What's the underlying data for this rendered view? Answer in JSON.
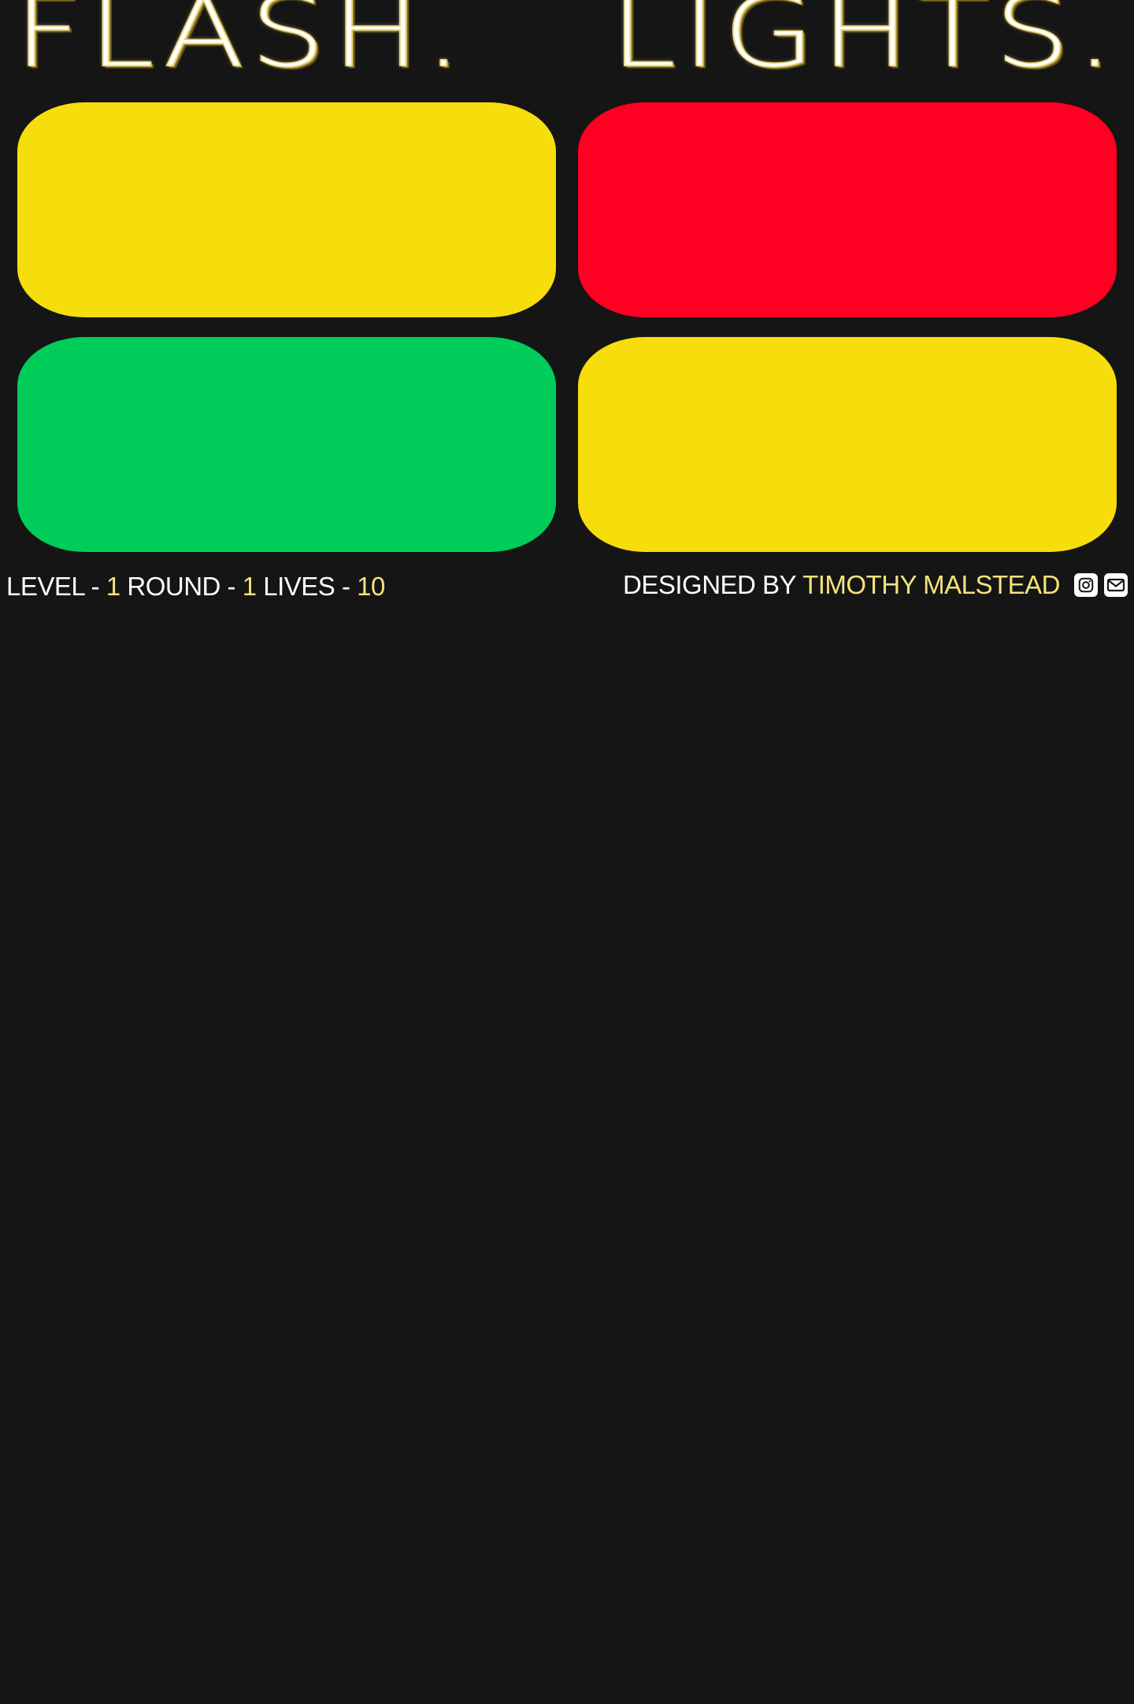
{
  "header": {
    "title_left": "FLASH.",
    "title_right": "LIGHTS."
  },
  "lights": [
    {
      "position": "top-left",
      "color": "#f6dd0c"
    },
    {
      "position": "top-right",
      "color": "#ff0022"
    },
    {
      "position": "bottom-left",
      "color": "#00cc5a"
    },
    {
      "position": "bottom-right",
      "color": "#f8dd0c"
    }
  ],
  "status": {
    "level_label": "LEVEL -",
    "level_value": "1",
    "round_label": "ROUND -",
    "round_value": "1",
    "lives_label": "LIVES -",
    "lives_value": "10"
  },
  "footer": {
    "designed_by_label": "DESIGNED BY",
    "designer_name": "TIMOTHY MALSTEAD",
    "icons": [
      "instagram-icon",
      "mail-icon"
    ]
  },
  "colors": {
    "background": "#151515",
    "accent": "#f6e27a",
    "text": "#ffffff"
  }
}
